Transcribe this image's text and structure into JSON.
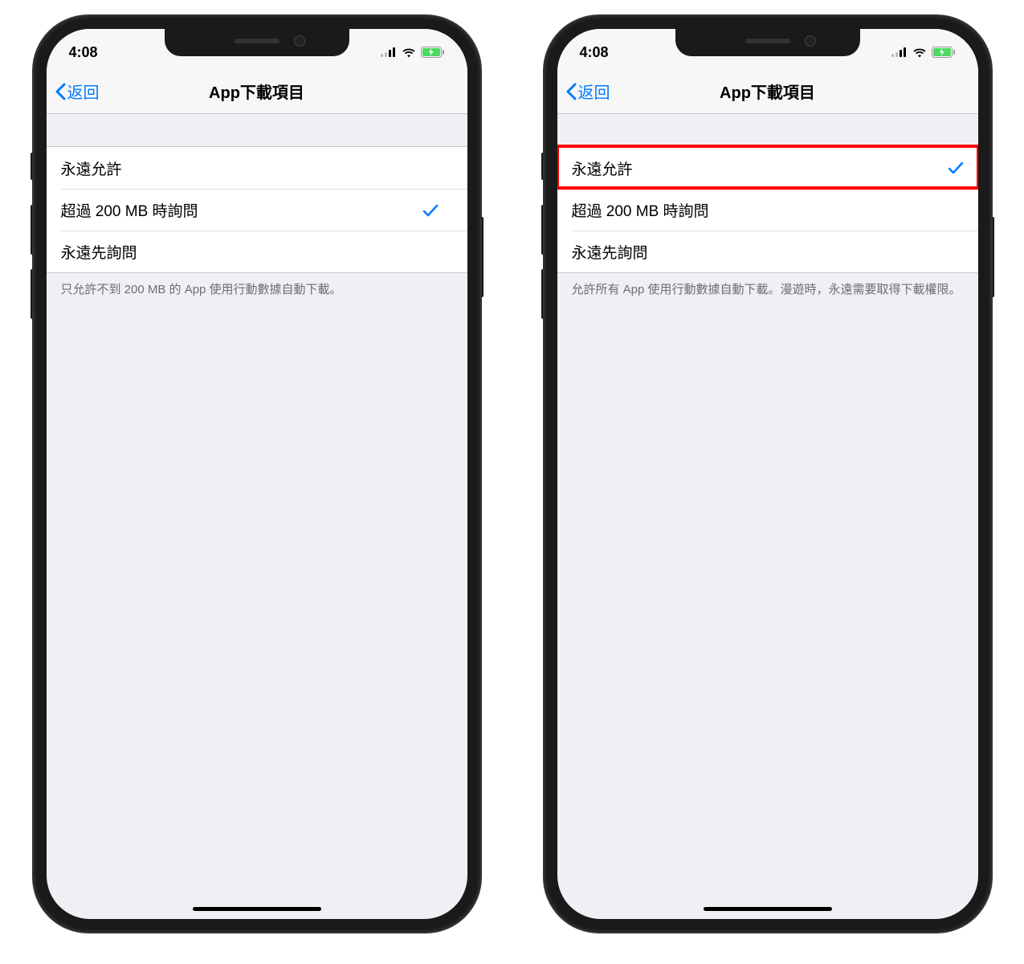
{
  "status": {
    "time": "4:08"
  },
  "nav": {
    "back_label": "返回",
    "title": "App下載項目"
  },
  "options": {
    "always_allow": "永遠允許",
    "ask_over_200": "超過 200 MB 時詢問",
    "always_ask": "永遠先詢問"
  },
  "phoneA": {
    "selected_index": 1,
    "footer": "只允許不到 200 MB 的 App 使用行動數據自動下載。"
  },
  "phoneB": {
    "selected_index": 0,
    "footer": "允許所有 App 使用行動數據自動下載。漫遊時，永遠需要取得下載權限。"
  },
  "colors": {
    "ios_blue": "#007aff",
    "battery_green": "#4cd964",
    "highlight_red": "#ff0000"
  }
}
